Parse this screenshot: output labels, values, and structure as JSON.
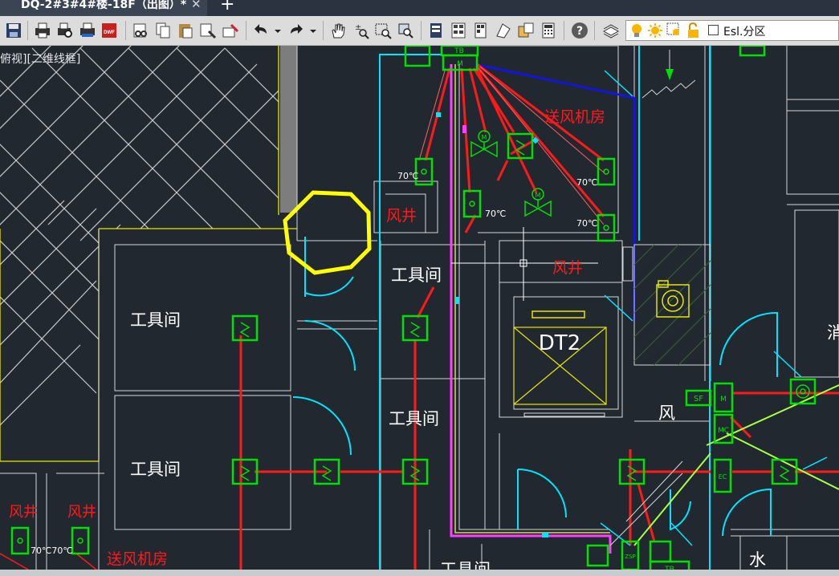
{
  "tab": {
    "title": "DQ-2#3#4#楼-18F（出图）*",
    "close": "✕",
    "new": "+"
  },
  "toolbar": {
    "icons": [
      "save-icon",
      "print-icon",
      "print-preview-icon",
      "plot-icon",
      "dwf-export-icon",
      "cut-icon",
      "copy-icon",
      "paste-icon",
      "match-properties-icon",
      "brush-icon",
      "undo-icon",
      "undo-dropdown-icon",
      "redo-icon",
      "redo-dropdown-icon",
      "pan-icon",
      "zoom-realtime-icon",
      "zoom-window-icon",
      "zoom-previous-icon",
      "properties-icon",
      "design-center-icon",
      "tool-palettes-icon",
      "sheet-set-icon",
      "markup-icon",
      "calculator-icon",
      "help-icon",
      "layer-properties-icon"
    ],
    "dwf_label": "DWF",
    "layer": {
      "name": "Esl.分区",
      "checked": false
    }
  },
  "viewport_label": "俯视][二维线框]",
  "drawing": {
    "labels": {
      "fan_room_top": "送风机房",
      "fan_room_bottom": "送风机房",
      "shaft_1": "风井",
      "shaft_2": "风井",
      "shaft_left_1": "风井",
      "shaft_left_2": "风井",
      "tool_room_1": "工具间",
      "tool_room_2": "工具间",
      "tool_room_3": "工具间",
      "tool_room_4": "工具间",
      "tool_room_5": "工具间",
      "elevator": "DT2",
      "wind": "风",
      "water": "水",
      "fire_partial": "消",
      "temp_1": "70℃",
      "temp_2": "70℃",
      "temp_3": "70℃",
      "temp_4": "70℃",
      "temp_5": "70℃70℃",
      "tag_tb_top": "TB",
      "tag_m_top": "M",
      "tag_m_right": "M",
      "tag_mc": "MC",
      "tag_sf": "SF",
      "tag_ec": "EC",
      "tag_zs": "ZSP",
      "tag_tb_bottom": "TB",
      "valve_m1": "M",
      "valve_m2": "M"
    }
  },
  "colors": {
    "background": "#212830",
    "red": "#ff1a1a",
    "green": "#00e000",
    "cyan": "#00e5ff",
    "blue": "#1010ff",
    "yellow": "#ffff00",
    "magenta": "#ff40ff"
  }
}
